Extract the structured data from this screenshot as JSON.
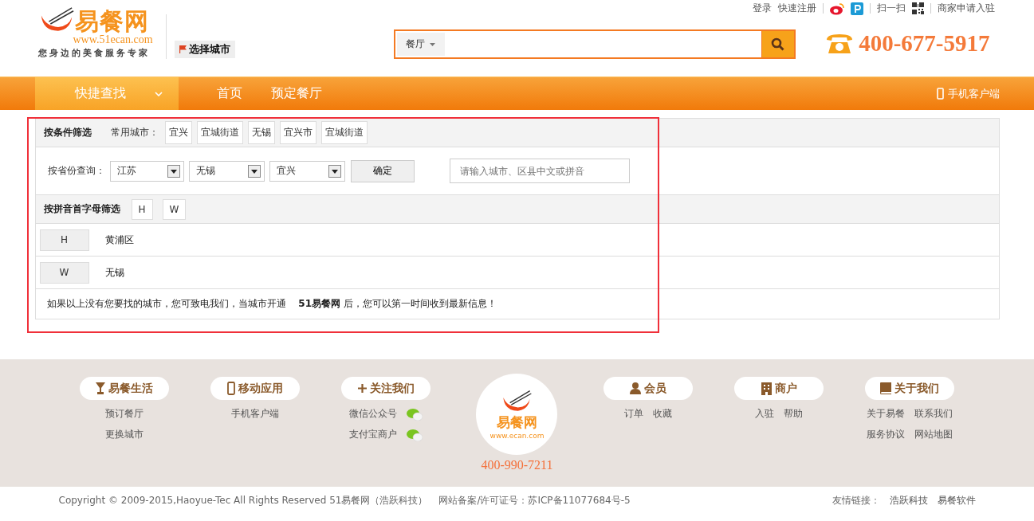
{
  "header": {
    "logo": {
      "name": "易餐网",
      "url": "www.51ecan.com",
      "slogan": "您身边的美食服务专家"
    },
    "city_button": "选择城市",
    "top_links": [
      "登录",
      "快速注册"
    ],
    "scan": "扫一扫",
    "merchant_link": "商家申请入驻",
    "search": {
      "category": "餐厅"
    },
    "phone": "400-677-5917"
  },
  "nav": {
    "items": [
      {
        "label": "快捷查找",
        "selected": true,
        "has_dropdown": true
      },
      {
        "label": "首页",
        "selected": false,
        "has_dropdown": false
      },
      {
        "label": "预定餐厅",
        "selected": false,
        "has_dropdown": false
      }
    ],
    "mobile": "手机客户端"
  },
  "filter": {
    "title": "按条件筛选",
    "common_label": "常用城市：",
    "common_cities": [
      "宜兴",
      "宜城街道",
      "无锡",
      "宜兴市",
      "宜城街道"
    ],
    "province_label": "按省份查询：",
    "selects": [
      {
        "value": "江苏"
      },
      {
        "value": "无锡"
      },
      {
        "value": "宜兴"
      }
    ],
    "confirm": "确定",
    "city_search": {
      "placeholder": "请输入城市、区县中文或拼音"
    },
    "pinyin_title": "按拼音首字母筛选",
    "letters": [
      "H",
      "W"
    ],
    "groups": [
      {
        "letter": "H",
        "cities": [
          "黄浦区"
        ]
      },
      {
        "letter": "W",
        "cities": [
          "无锡"
        ]
      }
    ],
    "notice": "如果以上没有您要找的城市，您可致电我们，当城市开通　 **51易餐网** 后，您可以第一时间收到最新信息！"
  },
  "footer": {
    "columns": [
      {
        "title": "易餐生活",
        "rows": [
          {
            "links": [
              "预订餐厅"
            ],
            "wechat_icon": false
          },
          {
            "links": [
              "更换城市"
            ],
            "wechat_icon": false
          }
        ]
      },
      {
        "title": "移动应用",
        "rows": [
          {
            "links": [
              "手机客户端"
            ],
            "wechat_icon": false
          }
        ]
      },
      {
        "title": "关注我们",
        "rows": [
          {
            "links": [
              "微信公众号"
            ],
            "wechat_icon": true
          },
          {
            "links": [
              "支付宝商户"
            ],
            "wechat_icon": true
          }
        ]
      },
      {
        "title": "会员",
        "rows": [
          {
            "links": [
              "订单",
              "收藏"
            ],
            "wechat_icon": false
          }
        ]
      },
      {
        "title": "商户",
        "rows": [
          {
            "links": [
              "入驻",
              "帮助"
            ],
            "wechat_icon": false
          }
        ]
      },
      {
        "title": "关于我们",
        "rows": [
          {
            "links": [
              "关于易餐",
              "联系我们"
            ],
            "wechat_icon": false
          },
          {
            "links": [
              "服务协议",
              "网站地图"
            ],
            "wechat_icon": false
          }
        ]
      }
    ],
    "center_logo": {
      "name": "易餐网",
      "url": "www.ecan.com",
      "phone": "400-990-7211"
    }
  },
  "bottom": {
    "copyright": "Copyright © 2009-2015,Haoyue-Tec All Rights Reserved 51易餐网（浩跃科技）",
    "license": "网站备案/许可证号：苏ICP备11077684号-5",
    "friends_label": "友情链接：",
    "friends": [
      "浩跃科技",
      "易餐软件"
    ]
  }
}
